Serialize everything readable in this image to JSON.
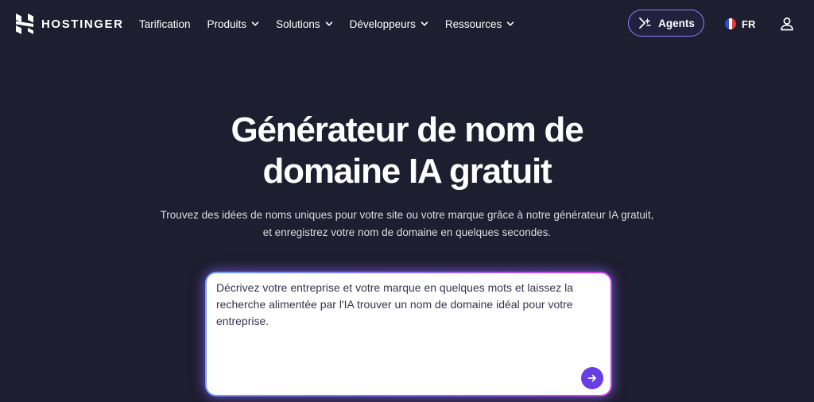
{
  "brand": {
    "name": "HOSTINGER",
    "logo_icon": "hostinger-h-logo"
  },
  "nav": {
    "items": [
      {
        "label": "Tarification",
        "has_dropdown": false
      },
      {
        "label": "Produits",
        "has_dropdown": true
      },
      {
        "label": "Solutions",
        "has_dropdown": true
      },
      {
        "label": "Développeurs",
        "has_dropdown": true
      },
      {
        "label": "Ressources",
        "has_dropdown": true
      }
    ],
    "agents_label": "Agents",
    "language": "FR",
    "user_icon": "user-icon"
  },
  "hero": {
    "title_line1": "Générateur de nom de",
    "title_line2": "domaine IA gratuit",
    "subtitle": "Trouvez des idées de noms uniques pour votre site ou votre marque grâce à notre générateur IA gratuit, et enregistrez votre nom de domaine en quelques secondes."
  },
  "prompt": {
    "placeholder": "Décrivez votre entreprise et votre marque en quelques mots et laissez la recherche alimentée par l'IA trouver un nom de domaine idéal pour votre entreprise.",
    "value": "",
    "submit_icon": "arrow-right-icon"
  },
  "colors": {
    "background": "#1d1e2f",
    "accent": "#673de6",
    "agents_border": "#8c85ff",
    "glow_start": "#6f9dff",
    "glow_end": "#d33cf0"
  }
}
